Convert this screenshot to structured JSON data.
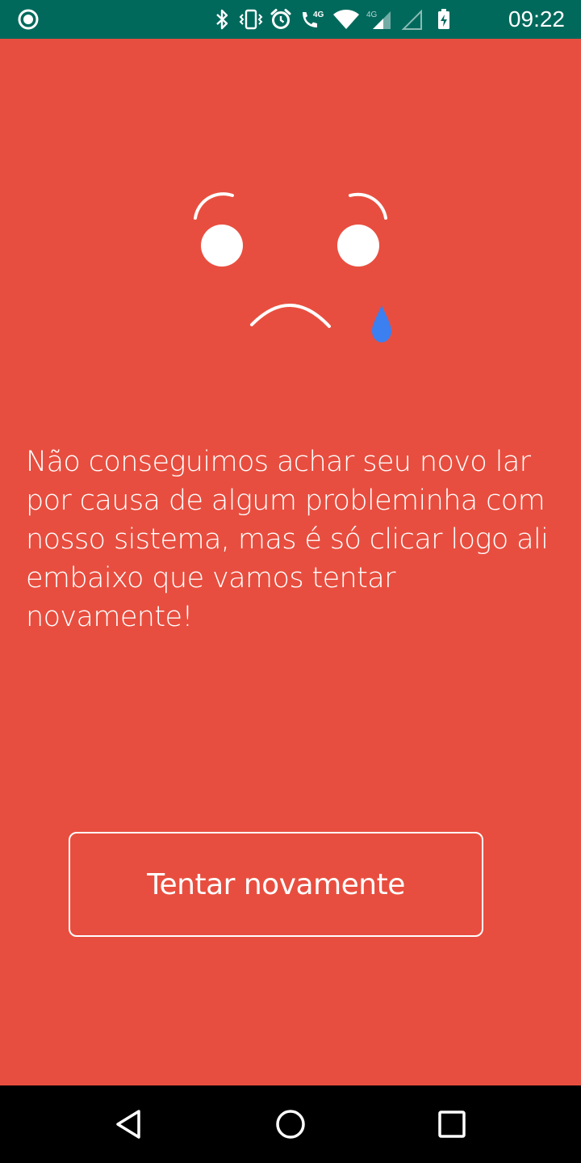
{
  "status_bar": {
    "time": "09:22",
    "network_label": "4G",
    "icons": [
      "record-icon",
      "bluetooth-icon",
      "vibrate-icon",
      "alarm-icon",
      "volte-call-icon",
      "wifi-icon",
      "signal-4g-icon",
      "signal-empty-icon",
      "battery-charging-icon"
    ]
  },
  "illustration": {
    "name": "sad-face-crying",
    "tear_color": "#3b7ff0"
  },
  "message": {
    "text": "Não conseguimos achar seu novo lar por causa de algum probleminha com nosso sistema, mas é só clicar logo ali embaixo que vamos tentar novamente!"
  },
  "retry_button": {
    "label": "Tentar novamente"
  },
  "nav_bar": {
    "buttons": [
      "back-icon",
      "home-icon",
      "recents-icon"
    ]
  },
  "colors": {
    "background": "#e84e3f",
    "status_bar": "#00695c",
    "text": "#ffffff"
  }
}
